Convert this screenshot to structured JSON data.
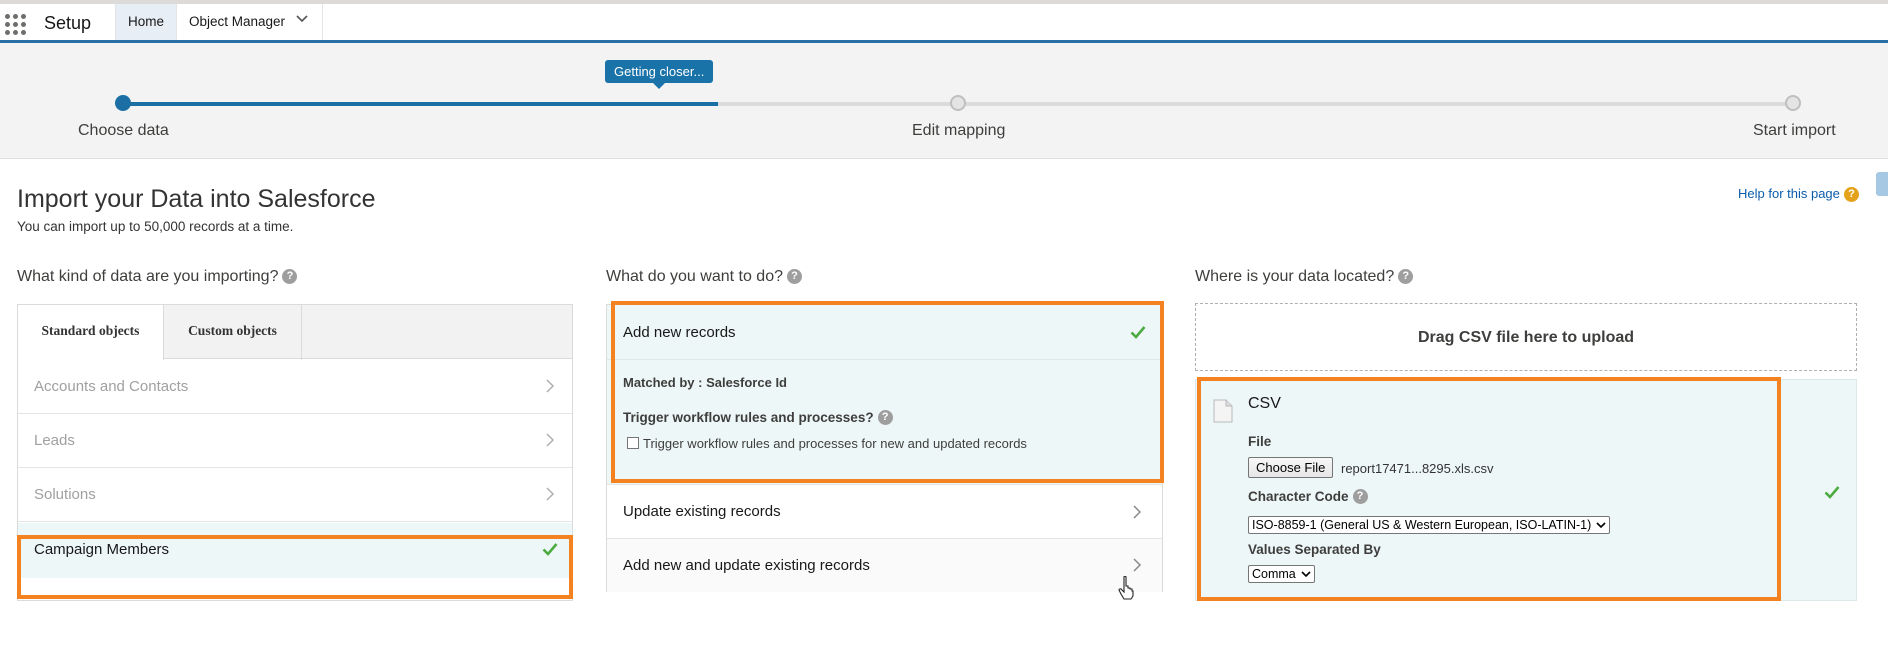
{
  "nav": {
    "app_name": "Setup",
    "tabs": [
      {
        "label": "Home"
      },
      {
        "label": "Object Manager"
      }
    ]
  },
  "progress": {
    "tooltip": "Getting closer...",
    "fill_fraction": 0.356,
    "steps": [
      {
        "label": "Choose data",
        "state": "done"
      },
      {
        "label": "Edit mapping",
        "state": "todo"
      },
      {
        "label": "Start import",
        "state": "todo"
      }
    ]
  },
  "header": {
    "title": "Import your Data into Salesforce",
    "subtitle": "You can import up to 50,000 records at a time.",
    "help_link": "Help for this page"
  },
  "data_kind": {
    "heading": "What kind of data are you importing?",
    "tabs": [
      {
        "label": "Standard objects"
      },
      {
        "label": "Custom objects"
      }
    ],
    "objects": [
      {
        "label": "Accounts and Contacts"
      },
      {
        "label": "Leads"
      },
      {
        "label": "Solutions"
      },
      {
        "label": "Campaign Members"
      }
    ]
  },
  "action": {
    "heading": "What do you want to do?",
    "options": [
      {
        "label": "Add new records"
      },
      {
        "label": "Update existing records"
      },
      {
        "label": "Add new and update existing records"
      }
    ],
    "matched_by": "Matched by : Salesforce Id",
    "trigger_question": "Trigger workflow rules and processes?",
    "trigger_checkbox": "Trigger workflow rules and processes for new and updated records",
    "trigger_checked": false
  },
  "location": {
    "heading": "Where is your data located?",
    "dropzone": "Drag CSV file here to upload",
    "source": "CSV",
    "file_label": "File",
    "choose_file_button": "Choose File",
    "file_name": "report17471...8295.xls.csv",
    "char_code_label": "Character Code",
    "char_code_value": "ISO-8859-1 (General US & Western European, ISO-LATIN-1)",
    "separator_label": "Values Separated By",
    "separator_value": "Comma"
  },
  "colors": {
    "brand_blue": "#1c6fa5",
    "highlight_orange": "#f58220",
    "success_green": "#4bab3f",
    "selected_bg": "#eef7f8"
  }
}
